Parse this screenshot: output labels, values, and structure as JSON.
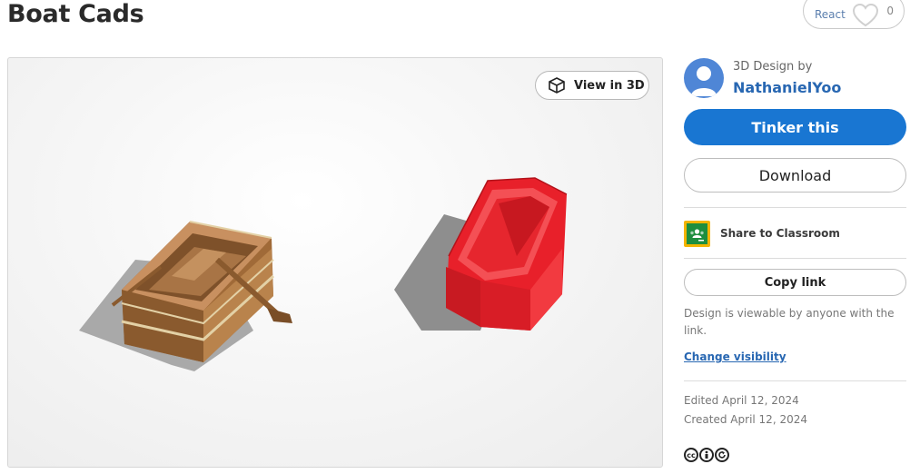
{
  "page": {
    "title": "Boat Cads"
  },
  "react": {
    "label": "React",
    "count": "0",
    "icon": "heart-icon"
  },
  "viewer": {
    "view3d_label": "View in 3D",
    "view3d_icon": "cube-icon",
    "objects": [
      "wooden rowboat with oars",
      "red hexagonal open box"
    ]
  },
  "sidebar": {
    "byline": "3D Design by",
    "author": "NathanielYoo",
    "tinker_label": "Tinker this",
    "download_label": "Download",
    "share_classroom_label": "Share to Classroom",
    "copy_link_label": "Copy link",
    "visibility_note": "Design is viewable by anyone with the link.",
    "change_visibility_label": "Change visibility",
    "edited": "Edited April 12, 2024",
    "created": "Created April 12, 2024",
    "license_icons": [
      "cc",
      "by",
      "sa"
    ]
  },
  "colors": {
    "primary": "#1976d2",
    "link": "#2867b2",
    "boat_wood": "#b07a45",
    "red_box": "#e8202a",
    "classroom_yellow": "#f3b400",
    "classroom_green": "#1e8e3e"
  }
}
